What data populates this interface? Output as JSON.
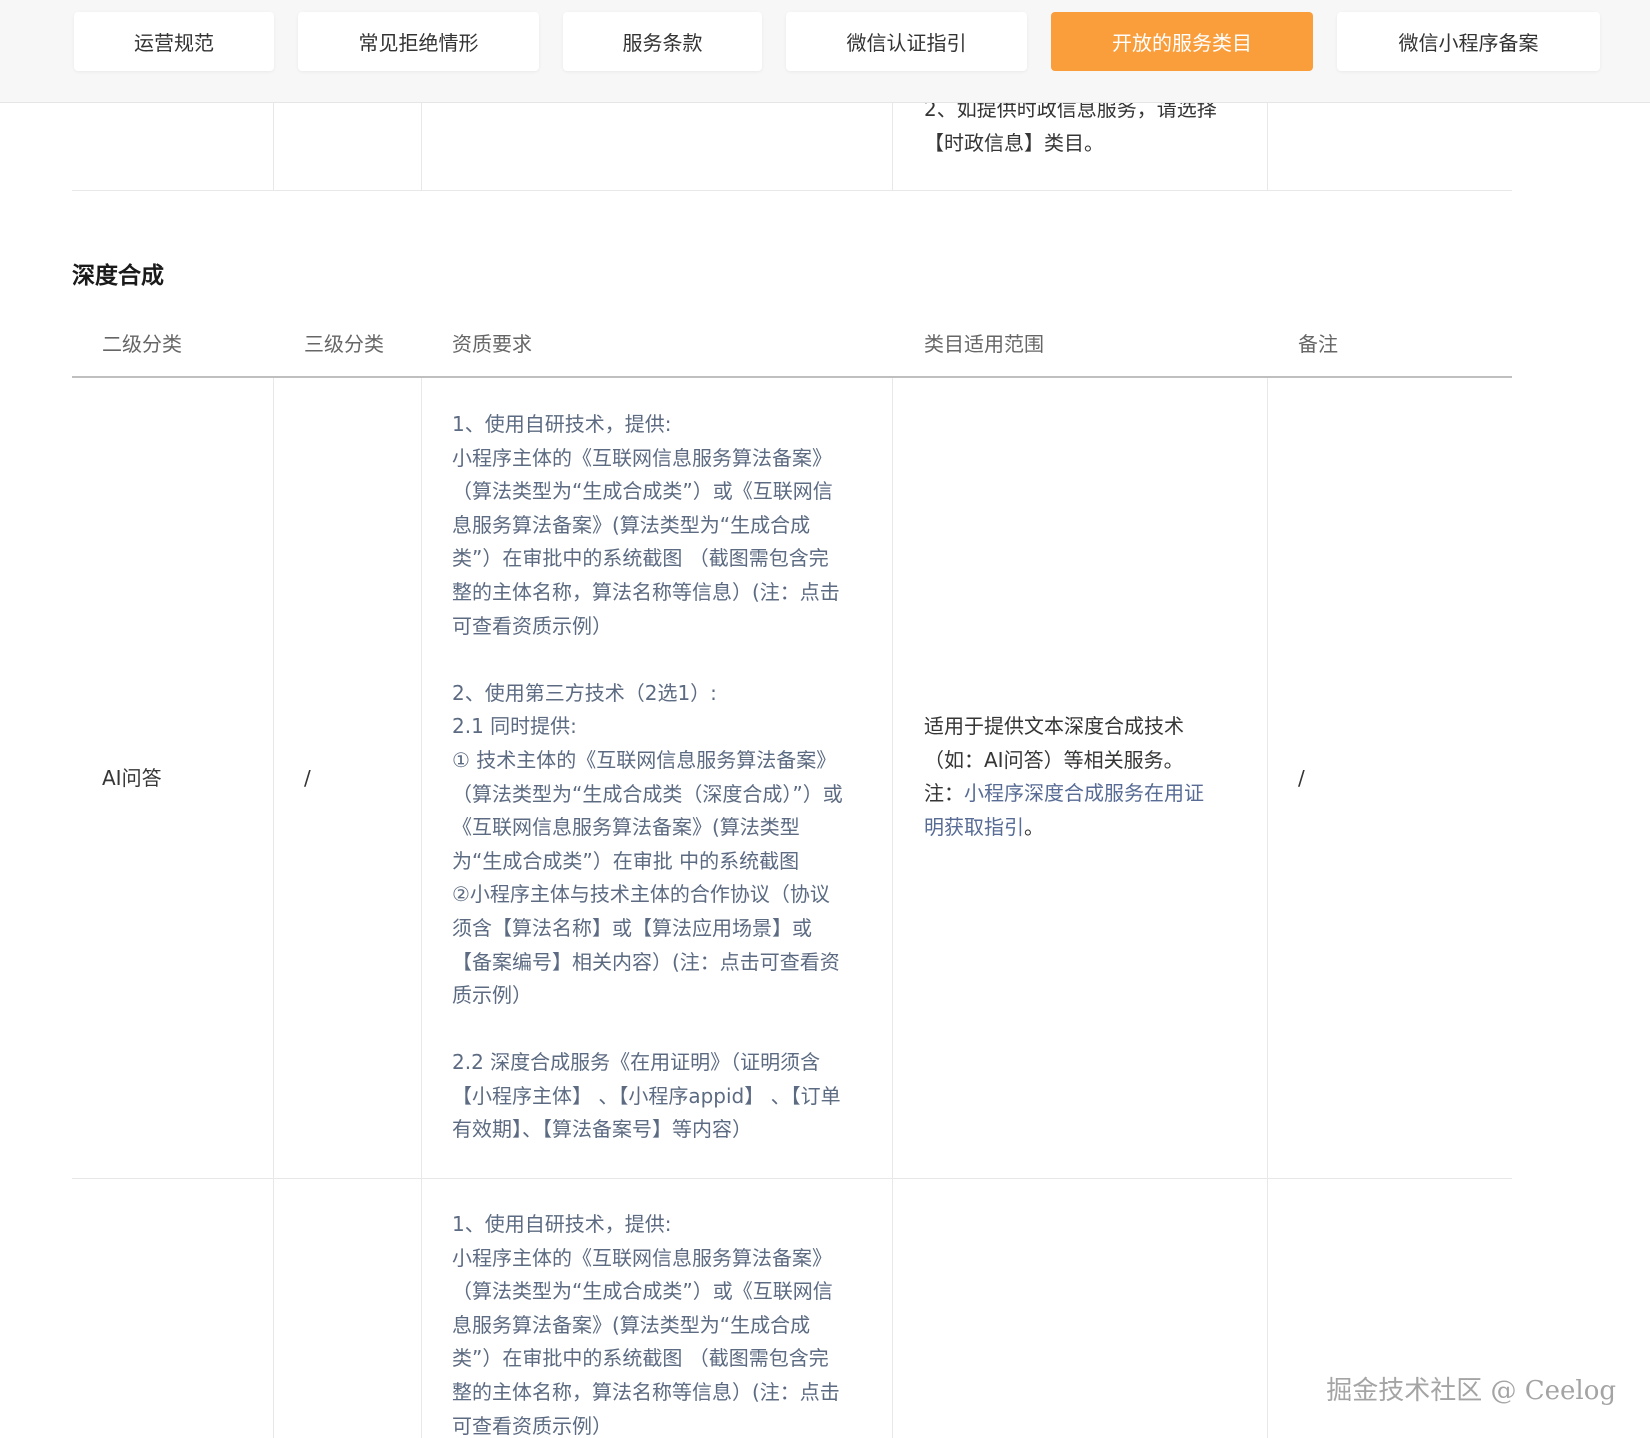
{
  "tabs": [
    {
      "label": "运营规范",
      "active": false
    },
    {
      "label": "常见拒绝情形",
      "active": false
    },
    {
      "label": "服务条款",
      "active": false
    },
    {
      "label": "微信认证指引",
      "active": false
    },
    {
      "label": "开放的服务类目",
      "active": true
    },
    {
      "label": "微信小程序备案",
      "active": false
    }
  ],
  "prev_row": {
    "scope_lines": [
      "2、如提供时政信息服务，请选择",
      "【时政信息】类目。"
    ]
  },
  "section": {
    "title": "深度合成",
    "headers": [
      "二级分类",
      "三级分类",
      "资质要求",
      "类目适用范围",
      "备注"
    ]
  },
  "rows": [
    {
      "level2": "AI问答",
      "level3": "/",
      "requirements": {
        "part1": [
          "1、使用自研技术，提供:",
          "小程序主体的《互联网信息服务算法备案》",
          "（算法类型为“生成合成类”）或《互联网信",
          "息服务算法备案》(算法类型为“生成合成",
          "类”）在审批中的系统截图 （截图需包含完",
          "整的主体名称，算法名称等信息）(注：点击",
          "可查看资质示例）"
        ],
        "part2": [
          "2、使用第三方技术（2选1）:",
          "2.1 同时提供:",
          "① 技术主体的《互联网信息服务算法备案》",
          "（算法类型为“生成合成类（深度合成）”）或",
          "《互联网信息服务算法备案》(算法类型",
          "为“生成合成类”）在审批 中的系统截图",
          "②小程序主体与技术主体的合作协议（协议",
          "须含【算法名称】或【算法应用场景】或",
          "【备案编号】相关内容）(注：点击可查看资",
          "质示例）"
        ],
        "part3": [
          "2.2 深度合成服务《在用证明》（证明须含",
          "【小程序主体】 、【小程序appid】 、【订单",
          "有效期】、【算法备案号】等内容）"
        ]
      },
      "scope": {
        "line1": "适用于提供文本深度合成技术",
        "line2": "（如：AI问答）等相关服务。",
        "note_prefix": "注：",
        "note_link_1": "小程序深度合成服务在用证",
        "note_link_2": "明获取指引",
        "note_suffix": "。"
      },
      "remark": "/"
    },
    {
      "requirements": {
        "part1": [
          "1、使用自研技术，提供:",
          "小程序主体的《互联网信息服务算法备案》",
          "（算法类型为“生成合成类”）或《互联网信",
          "息服务算法备案》(算法类型为“生成合成",
          "类”）在审批中的系统截图 （截图需包含完",
          "整的主体名称，算法名称等信息）(注：点击",
          "可查看资质示例）"
        ]
      }
    }
  ],
  "watermark": "掘金技术社区 @ Ceelog",
  "colors": {
    "accent": "#fa9d3b",
    "link": "#576b95",
    "body_text": "#5c6b82"
  }
}
